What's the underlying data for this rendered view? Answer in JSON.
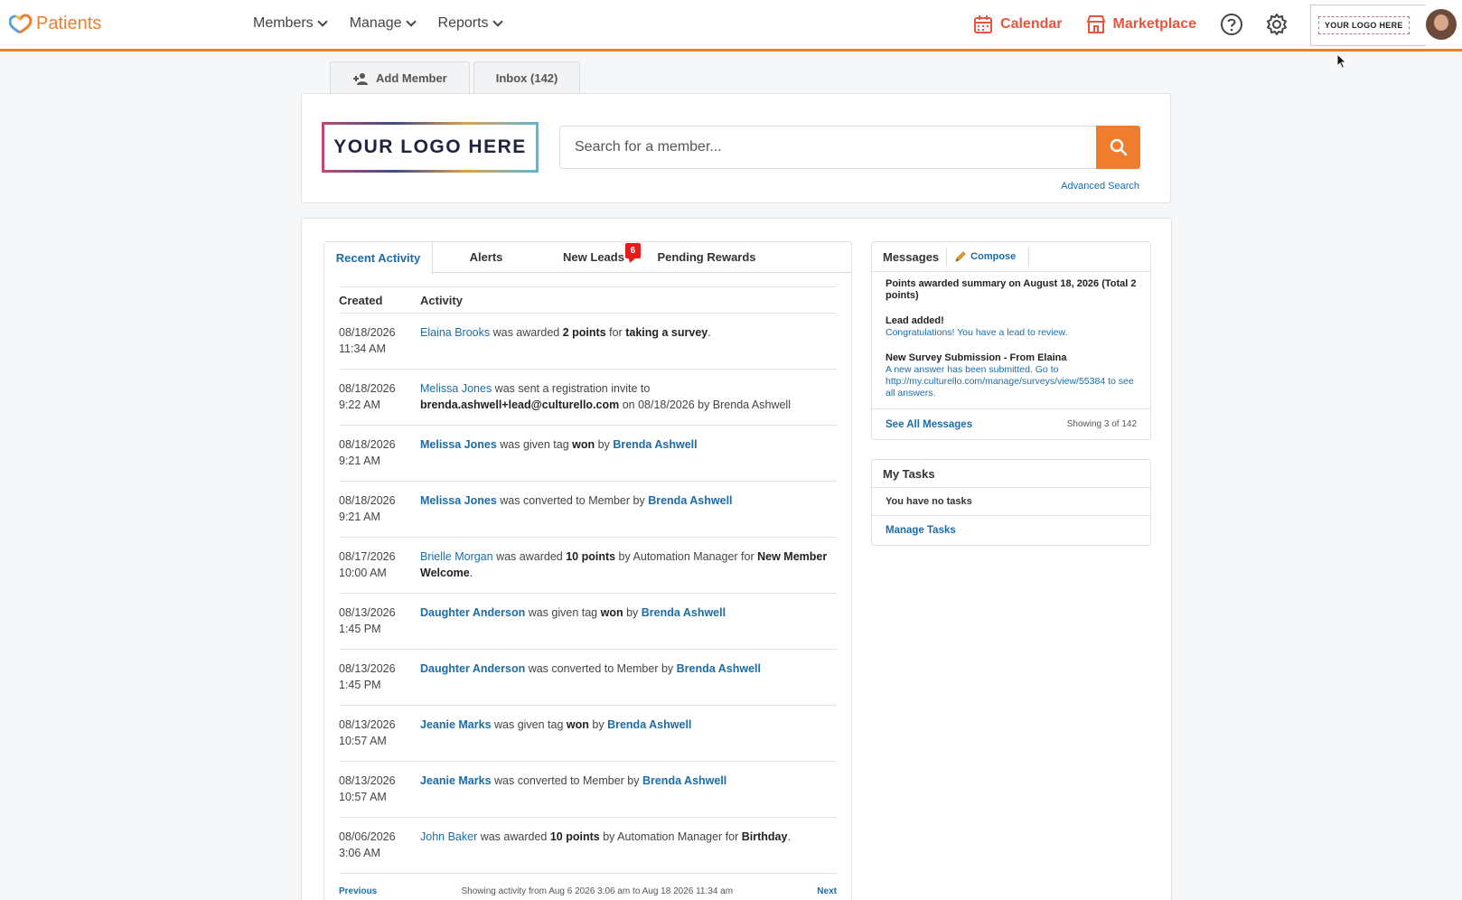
{
  "brand": {
    "name": "Patients",
    "accent": "#f07d2d"
  },
  "nav": [
    {
      "label": "Members"
    },
    {
      "label": "Manage"
    },
    {
      "label": "Reports"
    }
  ],
  "topright": {
    "calendar": "Calendar",
    "marketplace": "Marketplace",
    "logo_text": "YOUR LOGO HERE"
  },
  "toptabs": {
    "add_member": "Add Member",
    "inbox": "Inbox (142)"
  },
  "search": {
    "logo_text": "YOUR LOGO HERE",
    "placeholder": "Search for a member...",
    "advanced": "Advanced Search"
  },
  "activity": {
    "tabs": {
      "recent": "Recent Activity",
      "alerts": "Alerts",
      "new_leads": "New Leads",
      "new_leads_badge": "6",
      "pending": "Pending Rewards"
    },
    "col_created": "Created",
    "col_activity": "Activity",
    "rows": [
      {
        "date": "08/18/2026",
        "time": "11:34 AM",
        "a1": "Elaina Brooks",
        "t1": " was awarded ",
        "b1": "2 points",
        "t2": " for ",
        "b2": "taking a survey",
        "t3": "."
      },
      {
        "date": "08/18/2026",
        "time": "9:22 AM",
        "a1": "Melissa Jones",
        "t1": " was sent a registration invite to",
        "b1": "brenda.ashwell+lead@culturello.com",
        "t2": " on 08/18/2026 by Brenda Ashwell"
      },
      {
        "date": "08/18/2026",
        "time": "9:21 AM",
        "a1": "Melissa Jones",
        "t1": " was given tag ",
        "b1": "won",
        "t2": " by ",
        "a2": "Brenda Ashwell"
      },
      {
        "date": "08/18/2026",
        "time": "9:21 AM",
        "a1": "Melissa Jones",
        "t1": " was converted to Member by ",
        "a2": "Brenda Ashwell"
      },
      {
        "date": "08/17/2026",
        "time": "10:00 AM",
        "a1": "Brielle Morgan",
        "t1": " was awarded ",
        "b1": "10 points",
        "t2": " by Automation Manager for ",
        "b2": "New Member Welcome",
        "t3": "."
      },
      {
        "date": "08/13/2026",
        "time": "1:45 PM",
        "a1": "Daughter Anderson",
        "t1": " was given tag ",
        "b1": "won",
        "t2": " by ",
        "a2": "Brenda Ashwell"
      },
      {
        "date": "08/13/2026",
        "time": "1:45 PM",
        "a1": "Daughter Anderson",
        "t1": " was converted to Member by ",
        "a2": "Brenda Ashwell"
      },
      {
        "date": "08/13/2026",
        "time": "10:57 AM",
        "a1": "Jeanie Marks",
        "t1": " was given tag ",
        "b1": "won",
        "t2": " by ",
        "a2": "Brenda Ashwell"
      },
      {
        "date": "08/13/2026",
        "time": "10:57 AM",
        "a1": "Jeanie Marks",
        "t1": " was converted to Member by ",
        "a2": "Brenda Ashwell"
      },
      {
        "date": "08/06/2026",
        "time": "3:06 AM",
        "a1": "John Baker",
        "t1": " was awarded ",
        "b1": "10 points",
        "t2": " by Automation Manager for ",
        "b2": "Birthday",
        "t3": "."
      }
    ],
    "footer": {
      "previous": "Previous",
      "showing": "Showing activity from Aug 6 2026 3:06 am to Aug 18 2026 11:34 am",
      "next": "Next"
    }
  },
  "messages": {
    "title": "Messages",
    "compose": "Compose",
    "items": [
      {
        "title": "Points awarded summary on August 18, 2026 (Total 2 points)",
        "text": ""
      },
      {
        "title": "Lead added!",
        "text": "Congratulations! You have a lead to review."
      },
      {
        "title": "New Survey Submission - From Elaina",
        "text": "A new answer has been submitted. Go to http://my.culturello.com/manage/surveys/view/55384 to see all answers."
      }
    ],
    "see_all": "See All Messages",
    "showing": "Showing 3 of 142"
  },
  "tasks": {
    "title": "My Tasks",
    "empty": "You have no tasks",
    "manage": "Manage Tasks"
  },
  "colors": {
    "accent": "#f07d2d",
    "link": "#1b6ca8",
    "red": "#e8543d",
    "badge": "#e61c1c"
  }
}
